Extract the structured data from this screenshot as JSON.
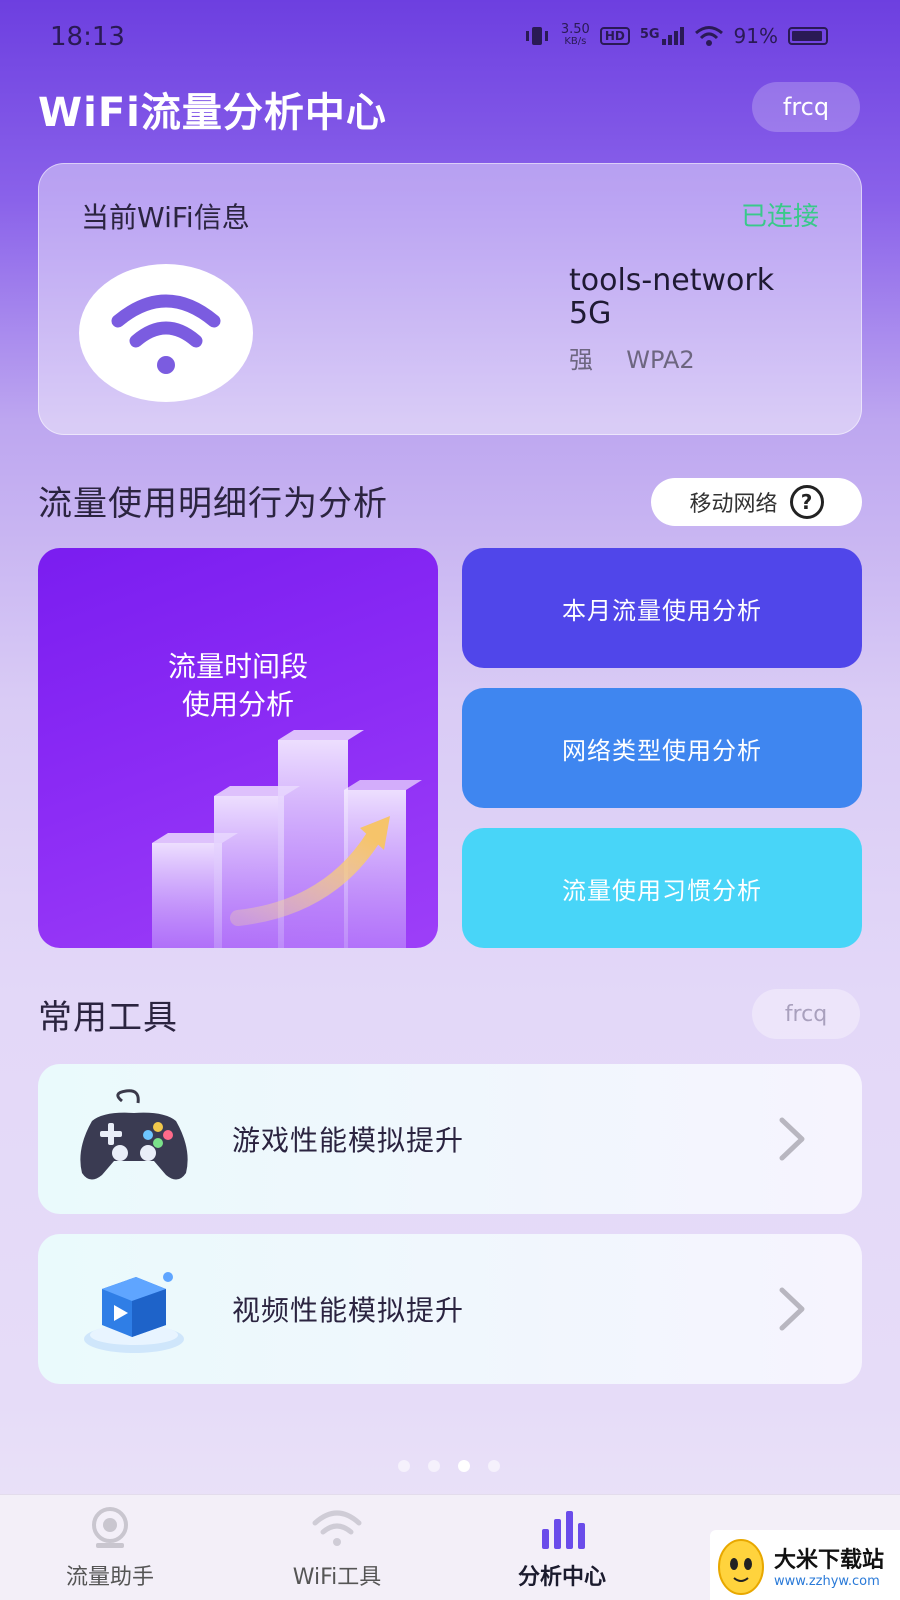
{
  "status_bar": {
    "time": "18:13",
    "speed_value": "3.50",
    "speed_unit": "KB/s",
    "hd": "HD",
    "network": "5G",
    "battery": "91%"
  },
  "header": {
    "title": "WiFi流量分析中心",
    "chip": "frcq"
  },
  "wifi_card": {
    "title": "当前WiFi信息",
    "status": "已连接",
    "status_color": "#39c98a",
    "ssid_line1": "tools-network",
    "ssid_line2": "5G",
    "signal": "强",
    "security": "WPA2",
    "icon": "wifi-icon"
  },
  "analysis": {
    "title": "流量使用明细行为分析",
    "network_pill": "移动网络",
    "help_icon": "?",
    "big_card_line1": "流量时间段",
    "big_card_line2": "使用分析",
    "buttons": [
      {
        "label": "本月流量使用分析",
        "color": "#5046ea"
      },
      {
        "label": "网络类型使用分析",
        "color": "#3f86f0"
      },
      {
        "label": "流量使用习惯分析",
        "color": "#48d5f8"
      }
    ]
  },
  "tools": {
    "title": "常用工具",
    "chip": "frcq",
    "items": [
      {
        "label": "游戏性能模拟提升",
        "icon": "gamepad-icon"
      },
      {
        "label": "视频性能模拟提升",
        "icon": "video-box-icon"
      }
    ]
  },
  "pager": {
    "count": 4,
    "active_index": 2
  },
  "tabbar": {
    "tabs": [
      {
        "label": "流量助手",
        "icon": "assistant-icon"
      },
      {
        "label": "WiFi工具",
        "icon": "wifi-icon"
      },
      {
        "label": "分析中心",
        "icon": "bar-chart-icon"
      }
    ],
    "active_index": 2
  },
  "watermark": {
    "name": "大米下载站",
    "url": "www.zzhyw.com"
  }
}
